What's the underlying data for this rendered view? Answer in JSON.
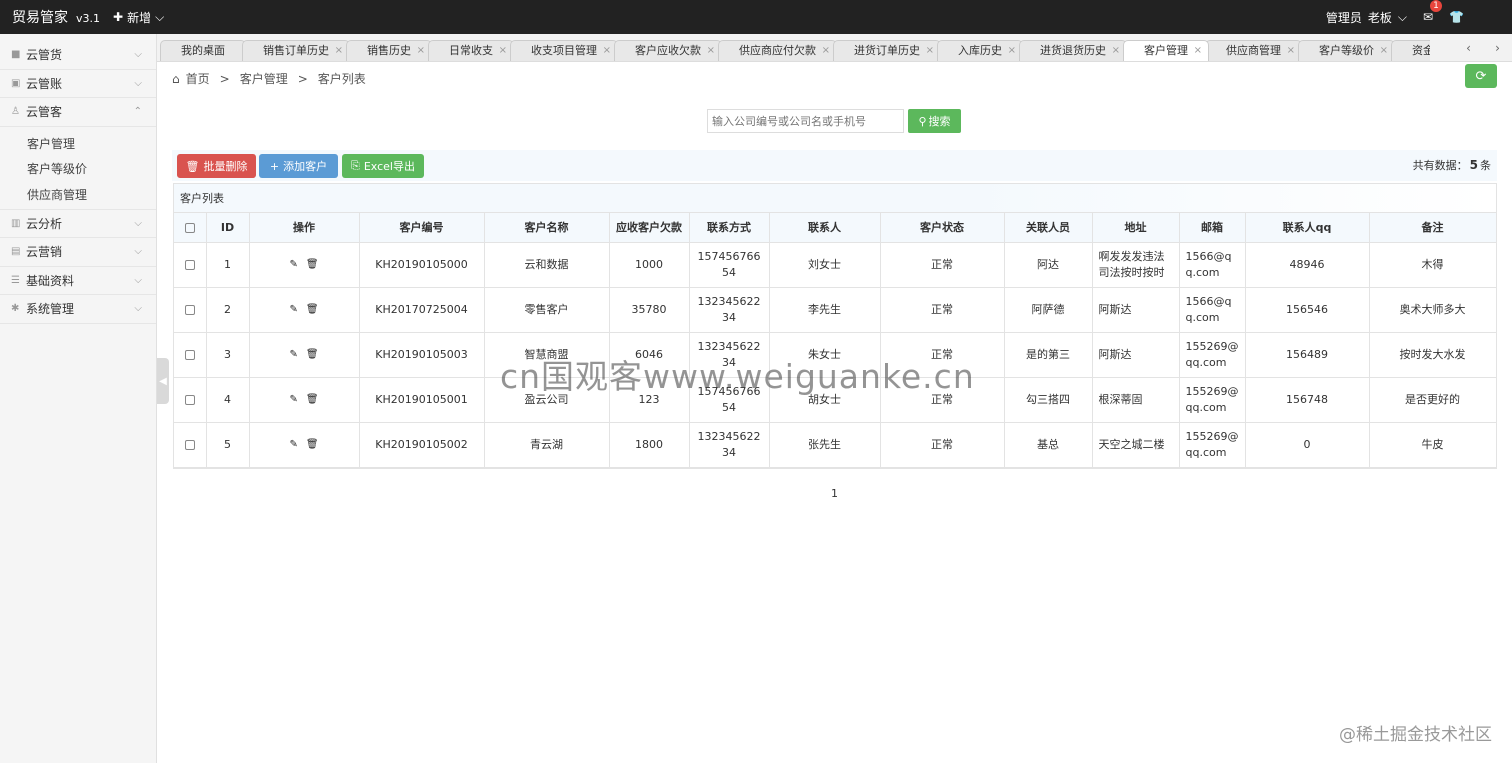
{
  "topbar": {
    "brand": "贸易管家",
    "version": "v3.1",
    "add_label": "新增",
    "role": "管理员",
    "user": "老板",
    "mail_badge": "1"
  },
  "sidebar": {
    "items": [
      {
        "label": "云管货",
        "icon": "truck-icon"
      },
      {
        "label": "云管账",
        "icon": "ledger-icon"
      },
      {
        "label": "云管客",
        "icon": "user-icon"
      },
      {
        "label": "云分析",
        "icon": "chart-icon"
      },
      {
        "label": "云营销",
        "icon": "list-icon"
      },
      {
        "label": "基础资料",
        "icon": "database-icon"
      },
      {
        "label": "系统管理",
        "icon": "cog-icon"
      }
    ],
    "subitems": [
      "客户管理",
      "客户等级价",
      "供应商管理"
    ]
  },
  "tabs": [
    "我的桌面",
    "销售订单历史",
    "销售历史",
    "日常收支",
    "收支项目管理",
    "客户应收欠款",
    "供应商应付欠款",
    "进货订单历史",
    "入库历史",
    "进货退货历史",
    "客户管理",
    "供应商管理",
    "客户等级价",
    "资金流"
  ],
  "active_tab": "客户管理",
  "breadcrumb": {
    "home": "首页",
    "sep": ">",
    "level1": "客户管理",
    "level2": "客户列表"
  },
  "search": {
    "placeholder": "输入公司编号或公司名或手机号",
    "button": "搜索"
  },
  "actions": {
    "batch_delete": "批量删除",
    "add_customer": "添加客户",
    "excel_export": "Excel导出"
  },
  "total": {
    "prefix": "共有数据：",
    "count": "5",
    "suffix": "条"
  },
  "table": {
    "title": "客户列表",
    "headers": [
      "ID",
      "操作",
      "客户编号",
      "客户名称",
      "应收客户欠款",
      "联系方式",
      "联系人",
      "客户状态",
      "关联人员",
      "地址",
      "邮箱",
      "联系人qq",
      "备注"
    ],
    "rows": [
      {
        "id": "1",
        "code": "KH20190105000",
        "name": "云和数据",
        "debt": "1000",
        "phone": "15745676654",
        "contact": "刘女士",
        "status": "正常",
        "related": "阿达",
        "address": "啊发发发违法司法按时按时",
        "email": "1566@qq.com",
        "qq": "48946",
        "note": "木得"
      },
      {
        "id": "2",
        "code": "KH20170725004",
        "name": "零售客户",
        "debt": "35780",
        "phone": "13234562234",
        "contact": "李先生",
        "status": "正常",
        "related": "阿萨德",
        "address": "阿斯达",
        "email": "1566@qq.com",
        "qq": "156546",
        "note": "奥术大师多大"
      },
      {
        "id": "3",
        "code": "KH20190105003",
        "name": "智慧商盟",
        "debt": "6046",
        "phone": "13234562234",
        "contact": "朱女士",
        "status": "正常",
        "related": "是的第三",
        "address": "阿斯达",
        "email": "155269@qq.com",
        "qq": "156489",
        "note": "按时发大水发"
      },
      {
        "id": "4",
        "code": "KH20190105001",
        "name": "盈云公司",
        "debt": "123",
        "phone": "15745676654",
        "contact": "胡女士",
        "status": "正常",
        "related": "勾三搭四",
        "address": "根深蒂固",
        "email": "155269@qq.com",
        "qq": "156748",
        "note": "是否更好的"
      },
      {
        "id": "5",
        "code": "KH20190105002",
        "name": "青云湖",
        "debt": "1800",
        "phone": "13234562234",
        "contact": "张先生",
        "status": "正常",
        "related": "基总",
        "address": "天空之城二楼",
        "email": "155269@qq.com",
        "qq": "0",
        "note": "牛皮"
      }
    ]
  },
  "pager": {
    "page": "1"
  },
  "watermark": "cn国观客www.weiguanke.cn",
  "corner_mark": "@稀土掘金技术社区"
}
